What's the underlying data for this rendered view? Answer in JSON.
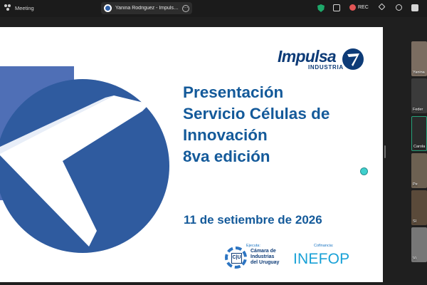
{
  "window": {
    "app_name": "Meeting",
    "tab_title": "Yanina Rodriguez - Impulsa Ind...",
    "record_label": "REC"
  },
  "slide": {
    "brand": {
      "name": "Impulsa",
      "subtitle": "INDUSTRIA"
    },
    "headline": [
      "Presentación",
      "Servicio Células de",
      "Innovación",
      "8va edición"
    ],
    "date": "11 de setiembre de 2026",
    "footer": {
      "ejecuta_label": "Ejecuta:",
      "ciu_text": "C|U",
      "camara_lines": [
        "Cámara de",
        "Industrias",
        "del Uruguay"
      ],
      "cofinancia_label": "Cofinancia:",
      "inefop_text": "INEFOP"
    }
  },
  "participants": [
    {
      "name": "Yanina"
    },
    {
      "name": "Feder"
    },
    {
      "name": "Carola"
    },
    {
      "name": "Pe"
    },
    {
      "name": "Sl"
    },
    {
      "name": "Vi"
    }
  ],
  "colors": {
    "topbar": "#1b1b1b",
    "brand_navy": "#0d3b77",
    "title_blue": "#145a9a",
    "inefop_blue": "#18a1d7",
    "record_red": "#e35555",
    "shield_green": "#1ea86a"
  },
  "icons": {
    "meeting": "people-icon",
    "tab_more": "more-icon",
    "security": "shield-icon",
    "expand": "expand-icon",
    "record": "record-icon",
    "magic": "wand-icon",
    "layout": "layout-icon"
  }
}
